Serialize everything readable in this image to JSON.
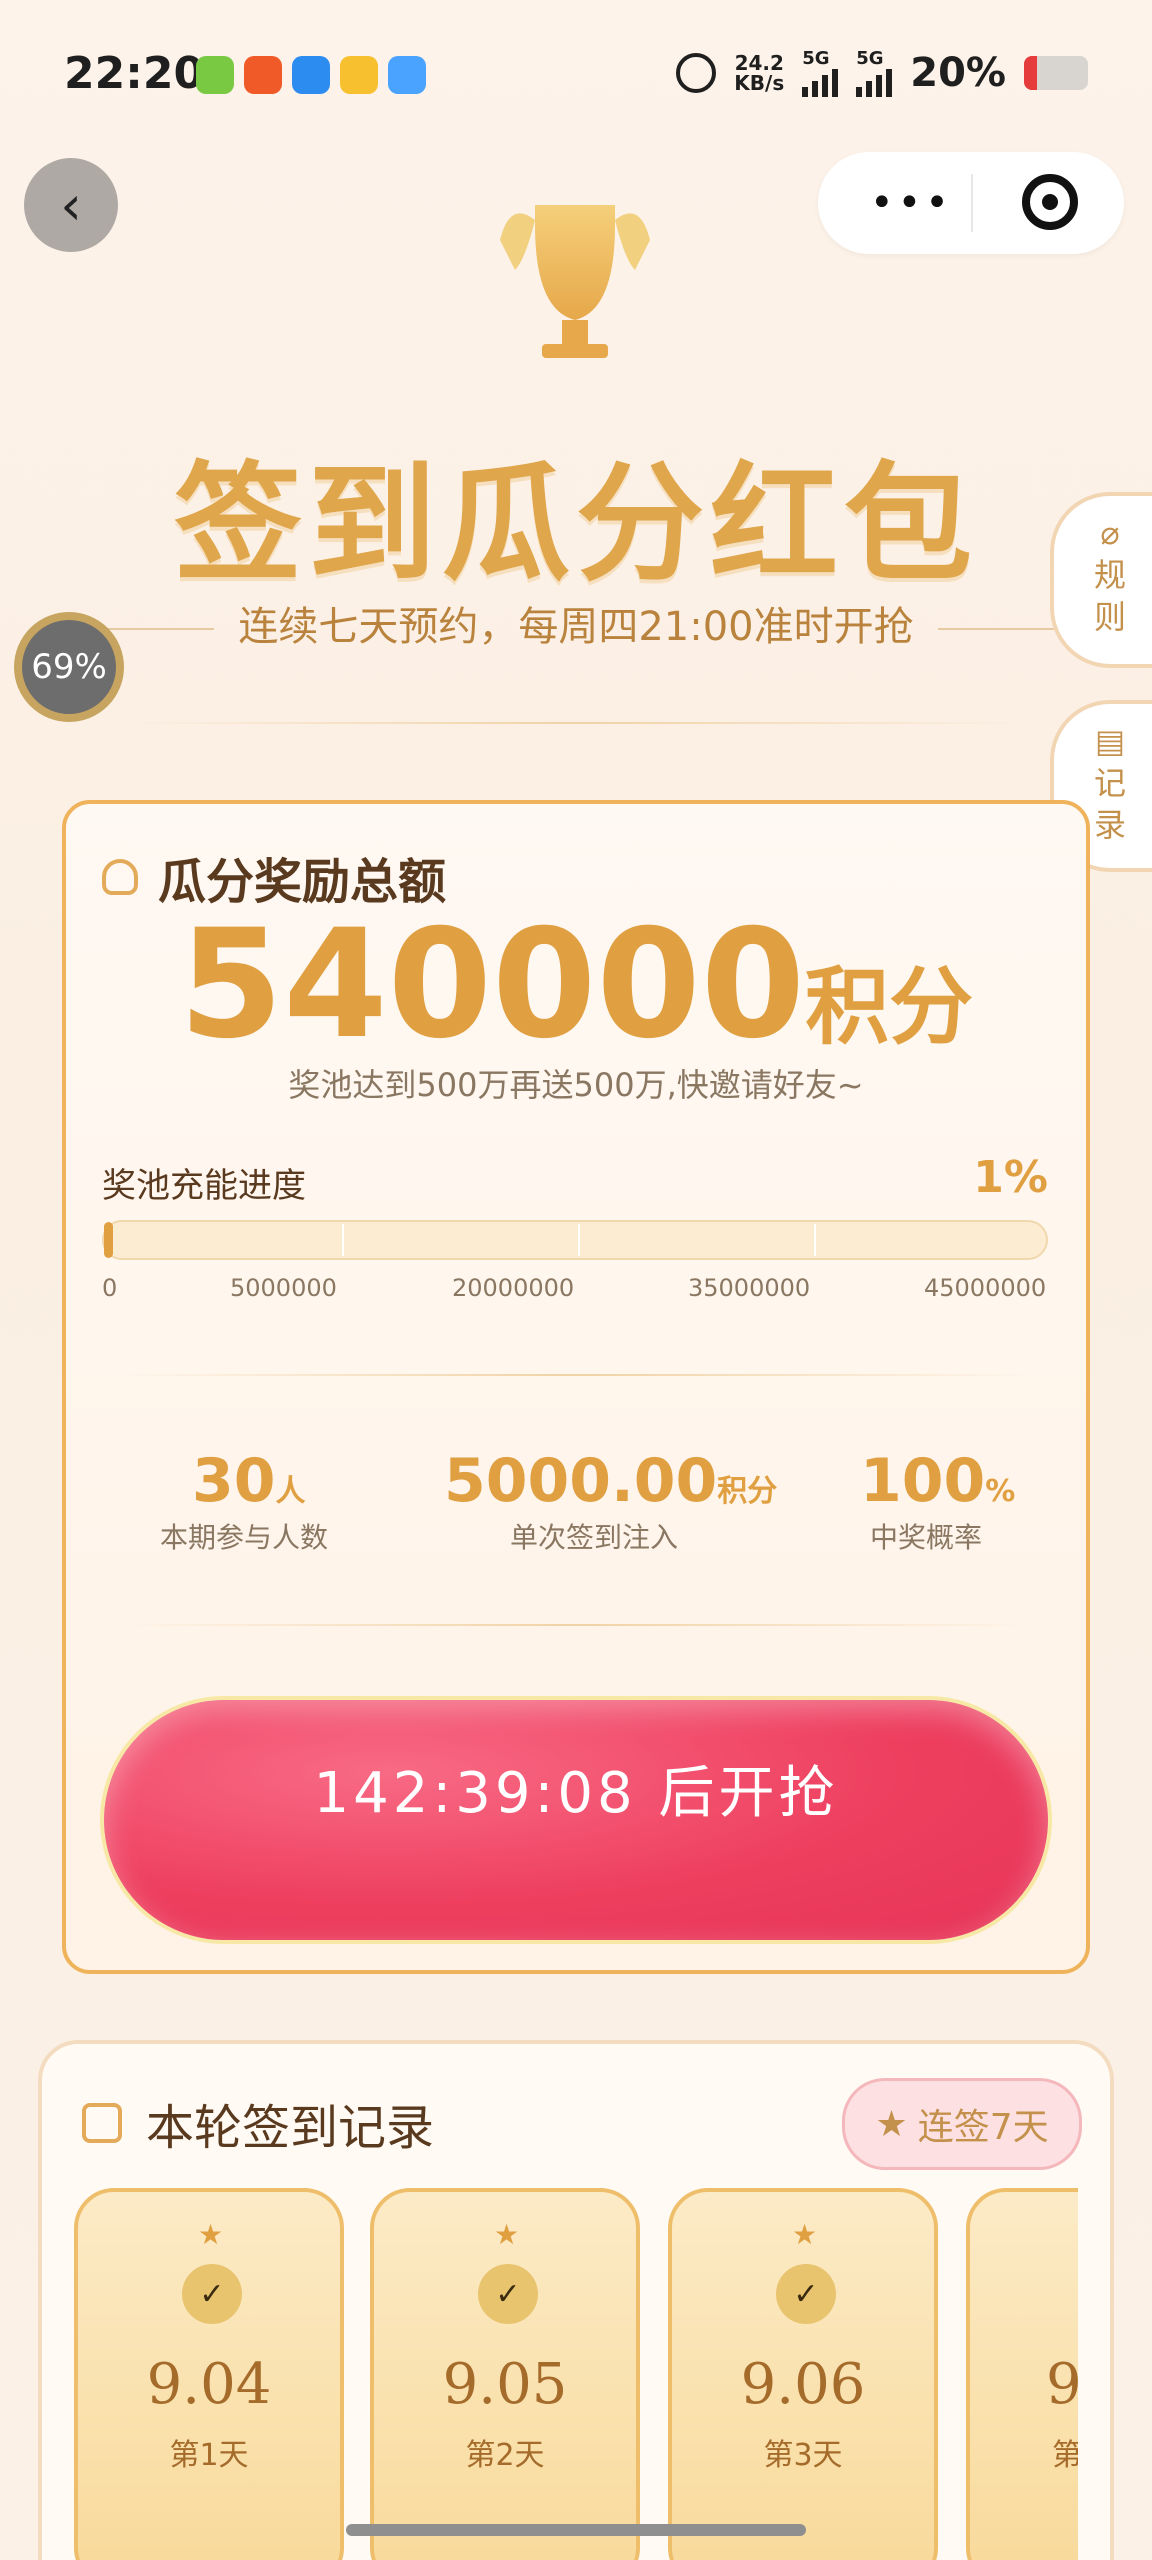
{
  "status_bar": {
    "time": "22:20",
    "net_speed_value": "24.2",
    "net_speed_unit": "KB/s",
    "sim1": "5G",
    "sim2": "5G",
    "battery": "20%"
  },
  "top_bar": {
    "back_icon": "chevron-left-icon",
    "more_icon": "more-dots-icon",
    "target_icon": "target-icon"
  },
  "hero": {
    "title": "签到瓜分红包",
    "subtitle": "连续七天预约，每周四21:00准时开抢",
    "progress_badge": "69%"
  },
  "side_tabs": {
    "rules": "规则",
    "records": "记录"
  },
  "reward_card": {
    "header": "瓜分奖励总额",
    "total": "540000",
    "unit": "积分",
    "note": "奖池达到500万再送500万,快邀请好友~",
    "pool_label": "奖池充能进度",
    "pool_percent": "1%",
    "progress_fraction": 0.01,
    "ticks": [
      "0",
      "5000000",
      "20000000",
      "35000000",
      "45000000"
    ],
    "stats": [
      {
        "value": "30",
        "unit": "人",
        "label": "本期参与人数"
      },
      {
        "value": "5000.00",
        "unit": "积分",
        "label": "单次签到注入"
      },
      {
        "value": "100",
        "unit": "%",
        "label": "中奖概率"
      }
    ],
    "cta": "142:39:08 后开抢"
  },
  "records": {
    "header": "本轮签到记录",
    "streak": "连签7天",
    "days": [
      {
        "date": "9.04",
        "label": "第1天"
      },
      {
        "date": "9.05",
        "label": "第2天"
      },
      {
        "date": "9.06",
        "label": "第3天"
      },
      {
        "date": "9",
        "label": "第"
      }
    ]
  }
}
